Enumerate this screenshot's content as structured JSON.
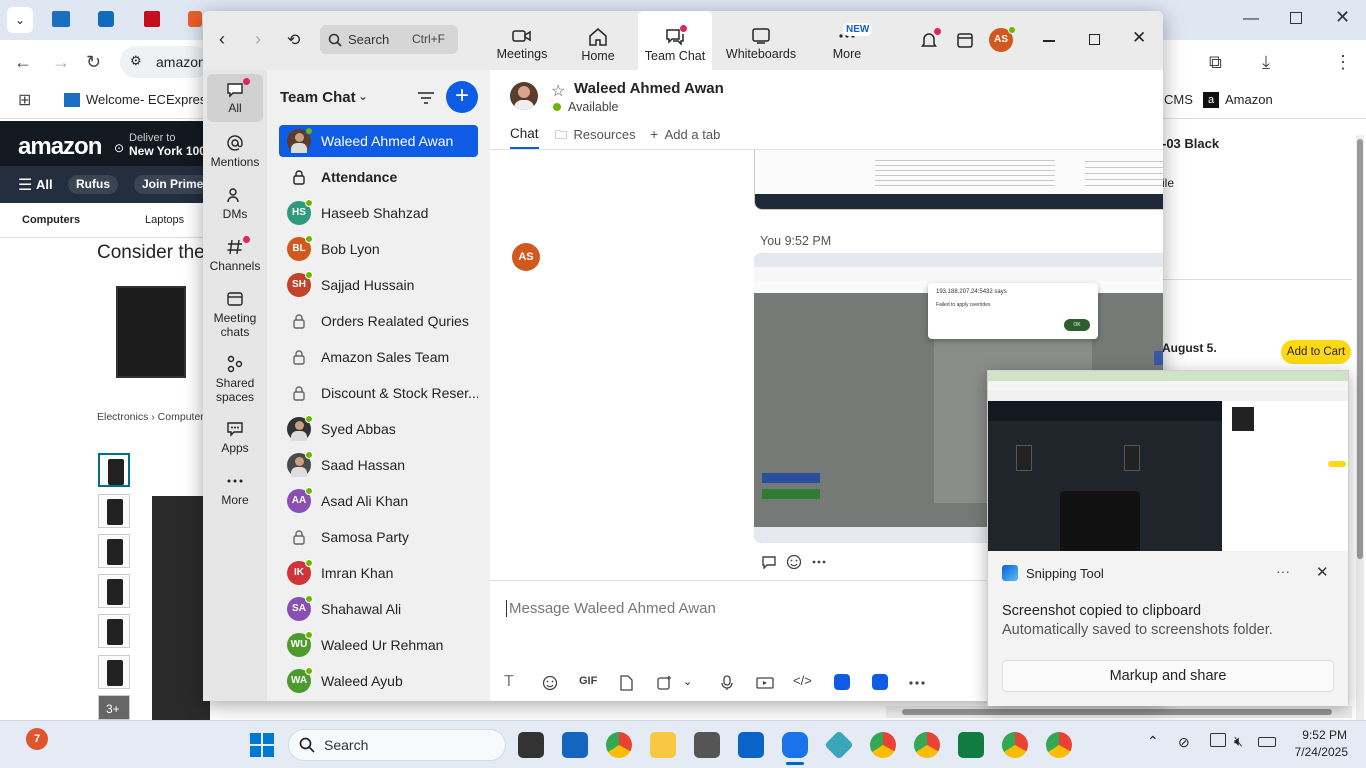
{
  "browser": {
    "address": "amazon",
    "bookmarks": [
      "Welcome- ECExpres...",
      "CMS",
      "Amazon"
    ],
    "amazon": {
      "deliver_to": "Deliver to",
      "location": "New York 100",
      "all": "All",
      "rufus": "Rufus",
      "join_prime": "Join Prime",
      "cat_computers": "Computers",
      "cat_laptops": "Laptops",
      "heading": "Consider the",
      "breadcrumb": "Electronics › Computer",
      "thumb_more": "3+",
      "product_title": "-03 Black",
      "product_sub": "ile",
      "delivery": "August 5.",
      "add_to_cart": "Add to Cart"
    }
  },
  "teams": {
    "search_placeholder": "Search",
    "search_shortcut": "Ctrl+F",
    "nav": [
      {
        "label": "Meetings"
      },
      {
        "label": "Home"
      },
      {
        "label": "Team Chat"
      },
      {
        "label": "Whiteboards"
      },
      {
        "label": "More"
      }
    ],
    "new_badge": "NEW",
    "user_initials": "AS",
    "rail": [
      {
        "label": "All"
      },
      {
        "label": "Mentions"
      },
      {
        "label": "DMs"
      },
      {
        "label": "Channels"
      },
      {
        "label": "Meeting chats"
      },
      {
        "label": "Shared spaces"
      },
      {
        "label": "Apps"
      },
      {
        "label": "More"
      }
    ],
    "list_title": "Team Chat",
    "chats": [
      {
        "name": "Waleed Ahmed Awan",
        "initials": "",
        "color": "#5a3d2b",
        "kind": "photo",
        "selected": true
      },
      {
        "name": "Attendance",
        "initials": "",
        "color": "",
        "kind": "lock",
        "bold": true
      },
      {
        "name": "Haseeb Shahzad",
        "initials": "HS",
        "color": "#2f9a7d",
        "kind": "avatar"
      },
      {
        "name": "Bob Lyon",
        "initials": "BL",
        "color": "#d3581f",
        "kind": "avatar"
      },
      {
        "name": "Sajjad Hussain",
        "initials": "SH",
        "color": "#c4422a",
        "kind": "avatar"
      },
      {
        "name": "Orders Realated Quries",
        "initials": "",
        "color": "",
        "kind": "lock"
      },
      {
        "name": "Amazon Sales Team",
        "initials": "",
        "color": "",
        "kind": "lock"
      },
      {
        "name": "Discount & Stock Reser...",
        "initials": "",
        "color": "",
        "kind": "lock"
      },
      {
        "name": "Syed Abbas",
        "initials": "",
        "color": "#333333",
        "kind": "photo"
      },
      {
        "name": "Saad Hassan",
        "initials": "",
        "color": "#4a4a4a",
        "kind": "photo"
      },
      {
        "name": "Asad Ali Khan",
        "initials": "AA",
        "color": "#8a4fb5",
        "kind": "avatar"
      },
      {
        "name": "Samosa Party",
        "initials": "",
        "color": "",
        "kind": "lock"
      },
      {
        "name": "Imran Khan",
        "initials": "IK",
        "color": "#d13438",
        "kind": "avatar"
      },
      {
        "name": "Shahawal Ali",
        "initials": "SA",
        "color": "#8a4fb5",
        "kind": "avatar"
      },
      {
        "name": "Waleed Ur Rehman",
        "initials": "WU",
        "color": "#4f9a2f",
        "kind": "avatar"
      },
      {
        "name": "Waleed Ayub",
        "initials": "WA",
        "color": "#4f9a2f",
        "kind": "avatar"
      }
    ],
    "contact": {
      "name": "Waleed Ahmed Awan",
      "status": "Available"
    },
    "tabs": [
      {
        "label": "Chat"
      },
      {
        "label": "Resources"
      },
      {
        "label": "Add a tab"
      }
    ],
    "message": {
      "sender_initials": "AS",
      "meta": "You 9:52 PM",
      "dialog_title": "193.188.207.24:5432 says",
      "dialog_text": "Failed to apply overrides",
      "dialog_ok": "OK"
    },
    "composer_placeholder": "Message Waleed Ahmed Awan",
    "composer_gif": "GIF"
  },
  "snipping": {
    "app": "Snipping Tool",
    "title": "Screenshot copied to clipboard",
    "subtitle": "Automatically saved to screenshots folder.",
    "button": "Markup and share"
  },
  "taskbar": {
    "widget_badge": "7",
    "search": "Search",
    "time": "9:52 PM",
    "date": "7/24/2025"
  },
  "colors": {
    "teams_accent": "#0e5ce6",
    "presence": "#6bb700",
    "avatar_as": "#d3581f",
    "amazon_dark": "#131921",
    "add_to_cart": "#ffd814"
  }
}
